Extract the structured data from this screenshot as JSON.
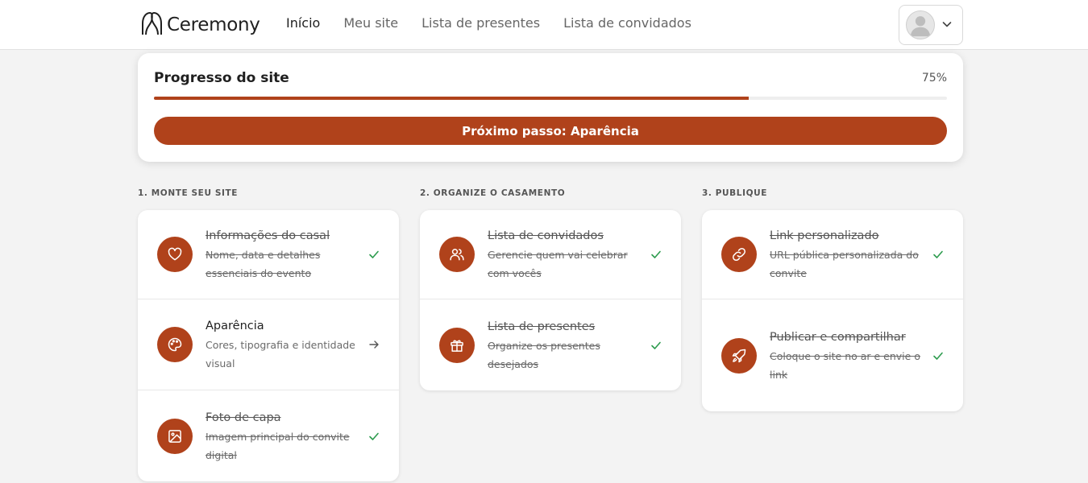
{
  "brand": {
    "name": "Ceremony",
    "accent": "#b0421b"
  },
  "nav": [
    {
      "label": "Início",
      "active": true
    },
    {
      "label": "Meu site",
      "active": false
    },
    {
      "label": "Lista de presentes",
      "active": false
    },
    {
      "label": "Lista de convidados",
      "active": false
    }
  ],
  "user_menu": {
    "avatar_icon": "user-icon",
    "caret_icon": "chevron-down-icon"
  },
  "progress": {
    "title": "Progresso do site",
    "percent_label": "75%",
    "percent": 75,
    "next_step_label": "Próximo passo: Aparência"
  },
  "columns": [
    {
      "heading": "1. Monte seu site",
      "steps": [
        {
          "title": "Informações do casal",
          "description": "Nome, data e detalhes essenciais do evento",
          "icon": "heart-icon",
          "status": "done"
        },
        {
          "title": "Aparência",
          "description": "Cores, tipografia e identidade visual",
          "icon": "palette-icon",
          "status": "next"
        },
        {
          "title": "Foto de capa",
          "description": "Imagem principal do convite digital",
          "icon": "image-icon",
          "status": "done"
        }
      ]
    },
    {
      "heading": "2. Organize o casamento",
      "steps": [
        {
          "title": "Lista de convidados",
          "description": "Gerencie quem vai celebrar com vocês",
          "icon": "users-icon",
          "status": "done"
        },
        {
          "title": "Lista de presentes",
          "description": "Organize os presentes desejados",
          "icon": "gift-icon",
          "status": "done"
        }
      ]
    },
    {
      "heading": "3. Publique",
      "steps": [
        {
          "title": "Link personalizado",
          "description": "URL pública personalizada do convite",
          "icon": "link-icon",
          "status": "done"
        },
        {
          "title": "Publicar e compartilhar",
          "description": "Coloque o site no ar e envie o link",
          "icon": "rocket-icon",
          "status": "done"
        }
      ]
    }
  ]
}
